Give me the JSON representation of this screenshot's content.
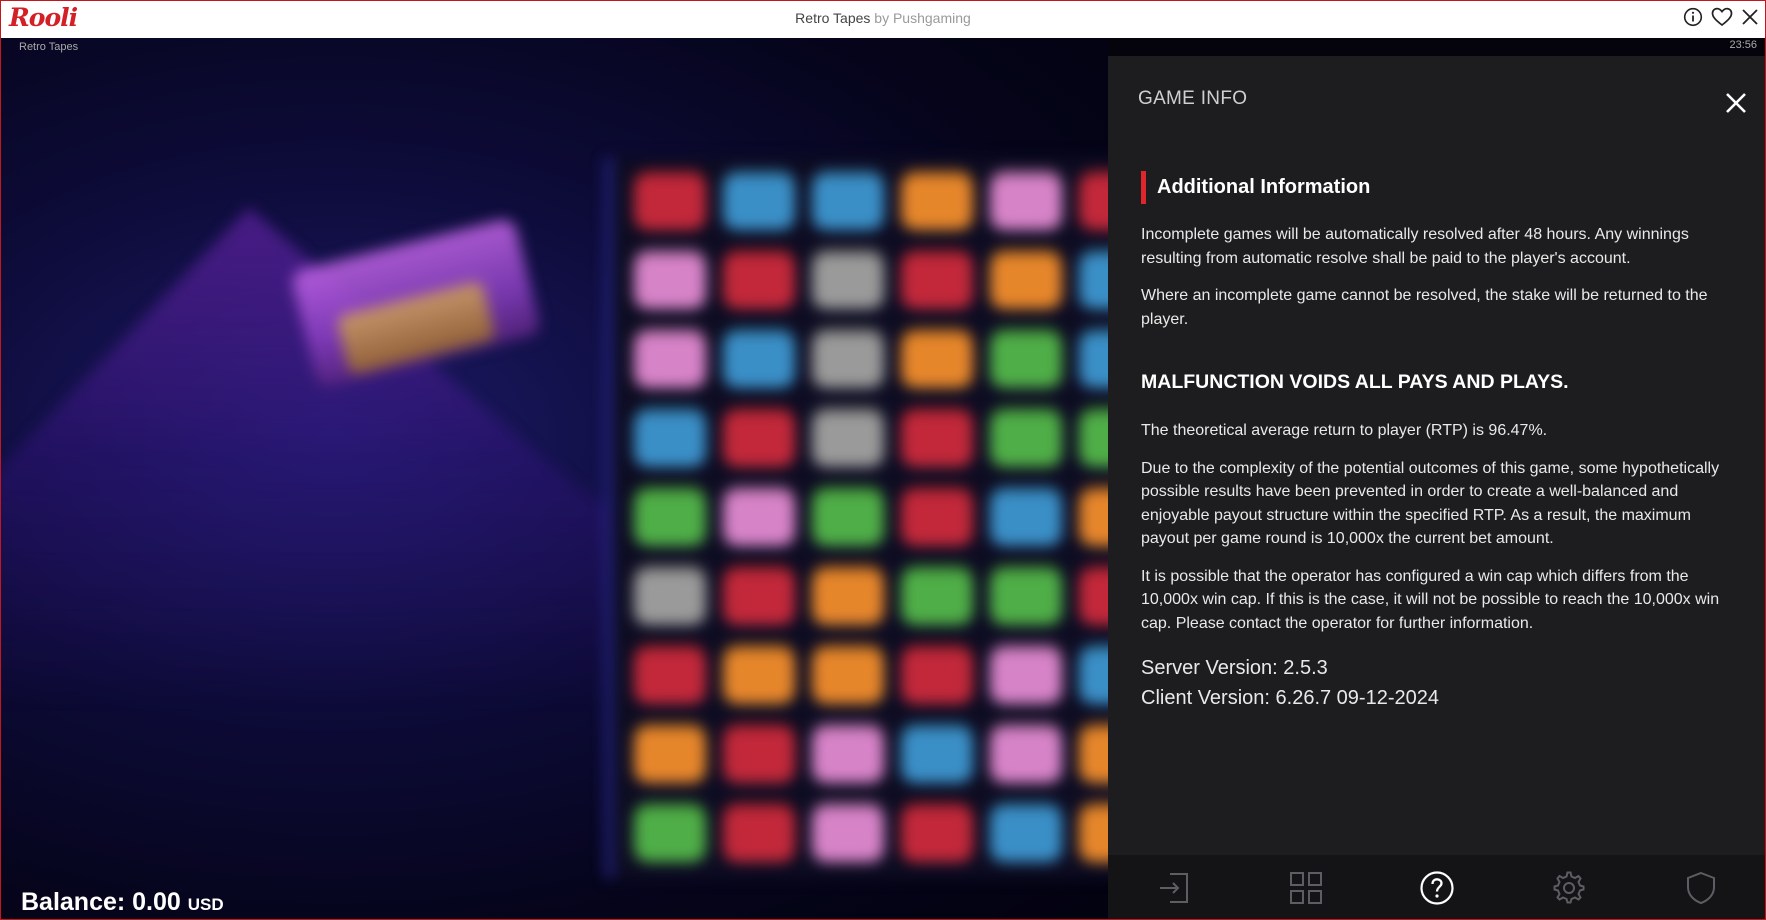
{
  "topbar": {
    "logo": "Rooli",
    "game_title": "Retro Tapes",
    "by_label": "by Pushgaming",
    "icons": [
      "info-icon",
      "heart-icon",
      "close-icon"
    ]
  },
  "game": {
    "subtitle": "Retro Tapes",
    "clock": "23:56",
    "balance_label": "Balance: 0.00",
    "currency": "USD"
  },
  "panel": {
    "header": "GAME INFO",
    "section_title": "Additional Information",
    "paragraphs": [
      "Incomplete games will be automatically resolved after 48 hours. Any winnings resulting from automatic resolve shall be paid to the player's account.",
      "Where an incomplete game cannot be resolved, the stake will be returned to the player."
    ],
    "warning": "MALFUNCTION VOIDS ALL PAYS AND PLAYS.",
    "rtp_text": "The theoretical average return to player (RTP) is 96.47%.",
    "complexity_text": "Due to the complexity of the potential outcomes of this game, some hypothetically possible results have been prevented in order to create a well-balanced and enjoyable payout structure within the specified RTP. As a result, the maximum payout per game round is 10,000x the current bet amount.",
    "wincap_text": "It is possible that the operator has configured a win cap which differs from the 10,000x win cap. If this is the case, it will not be possible to reach the 10,000x win cap. Please contact the operator for further information.",
    "server_version": "Server Version: 2.5.3",
    "client_version": "Client Version: 6.26.7 09-12-2024"
  },
  "nav": {
    "items": [
      "exit-icon",
      "grid-icon",
      "help-icon",
      "settings-icon",
      "shield-icon"
    ],
    "active": "help-icon"
  },
  "colors": {
    "accent_red": "#e0262d",
    "panel_bg": "#1d1d1f",
    "brand_red": "#d31f26"
  }
}
